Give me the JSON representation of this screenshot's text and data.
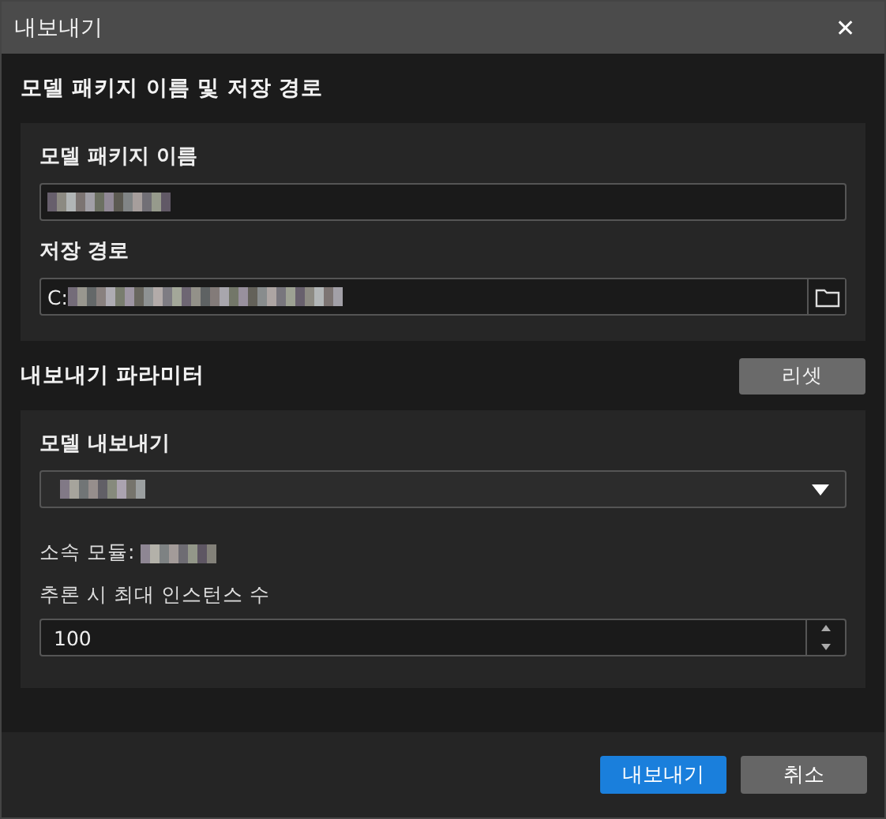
{
  "window": {
    "title": "내보내기",
    "close": "✕"
  },
  "package_section": {
    "title": "모델 패키지 이름 및 저장 경로",
    "name_label": "모델 패키지 이름",
    "path_label": "저장 경로",
    "path_prefix": "C:"
  },
  "params_section": {
    "title": "내보내기 파라미터",
    "reset_button": "리셋",
    "model_label": "모델 내보내기",
    "module_label": "소속 모듈:",
    "instances_label": "추론 시 최대 인스턴스 수",
    "instances_value": "100"
  },
  "buttons": [
    {
      "label": "내보내기",
      "kind": "primary"
    },
    {
      "label": "취소",
      "kind": "secondary"
    }
  ]
}
